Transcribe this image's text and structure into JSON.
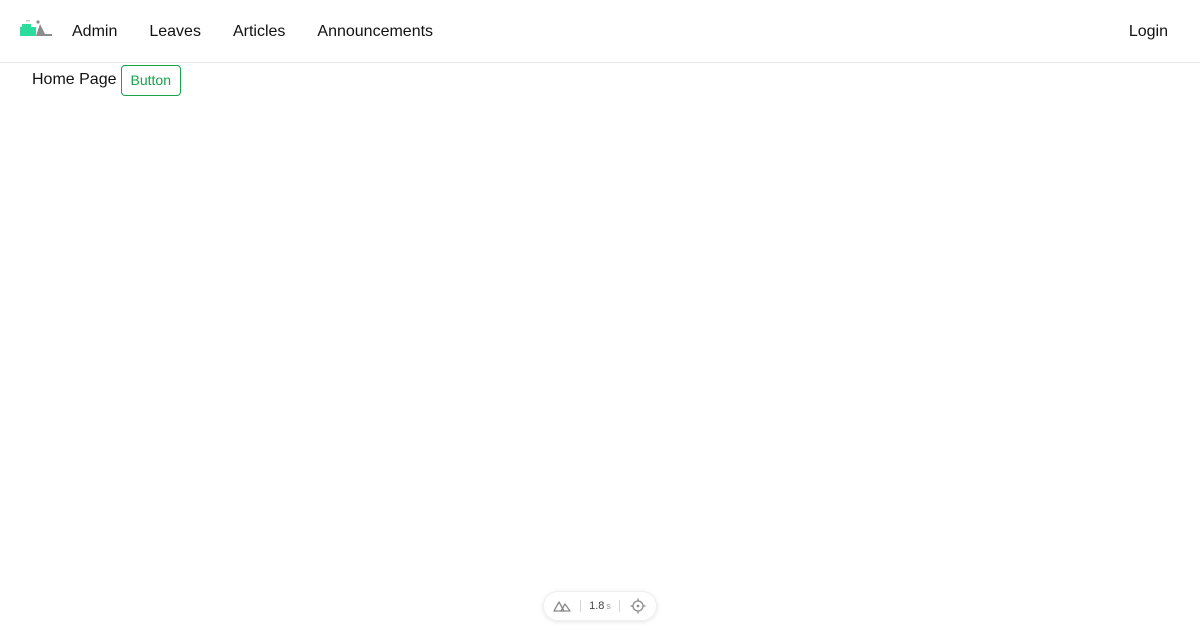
{
  "navbar": {
    "links": [
      {
        "label": "Admin"
      },
      {
        "label": "Leaves"
      },
      {
        "label": "Articles"
      },
      {
        "label": "Announcements"
      }
    ],
    "login_label": "Login"
  },
  "main": {
    "title": "Home Page",
    "button_label": "Button"
  },
  "devtools": {
    "time_value": "1.8",
    "time_unit": "s"
  },
  "colors": {
    "accent": "#16a34a",
    "logo_green": "#2ddc9c",
    "logo_gray": "#8c8c8c"
  },
  "icons": {
    "logo": "app-logo-icon",
    "devtools": "nuxt-mountain-icon",
    "inspect": "crosshair-icon"
  }
}
